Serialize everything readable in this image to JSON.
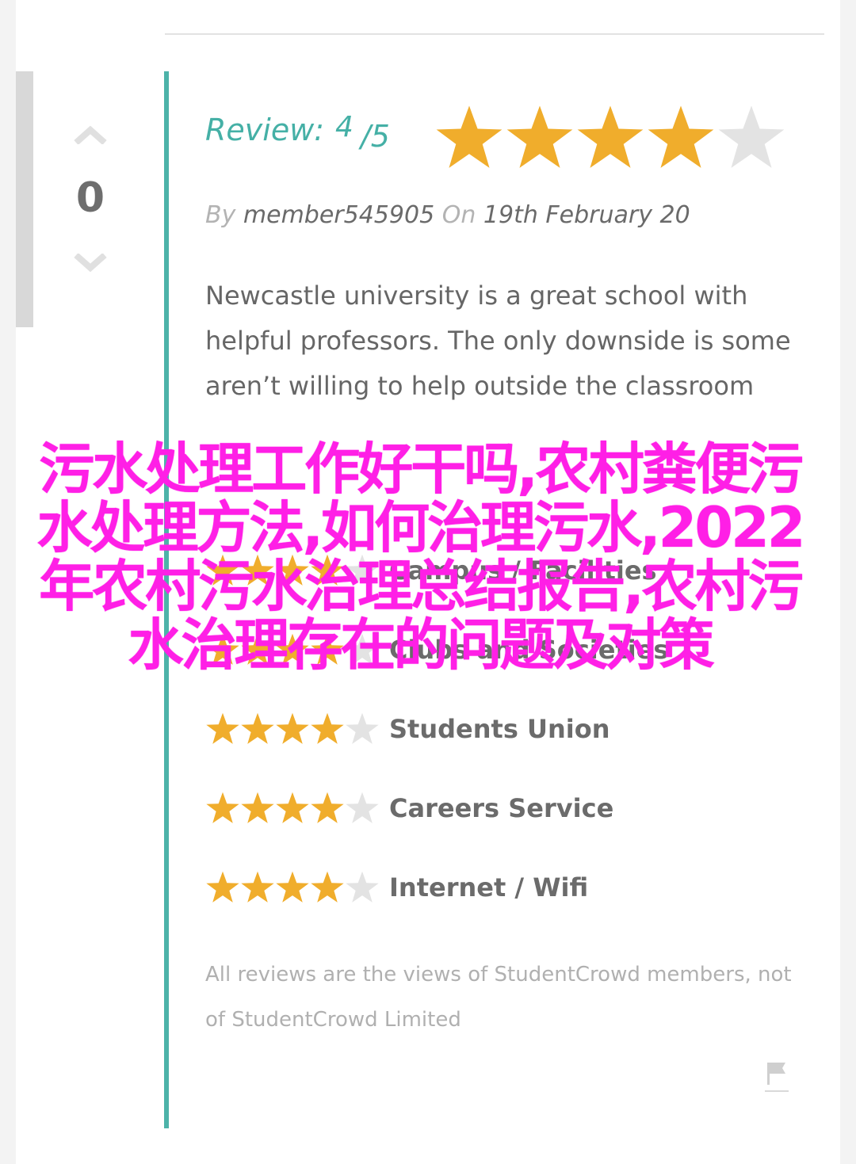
{
  "vote": {
    "count": "0"
  },
  "review": {
    "label": "Review:",
    "score": "4",
    "max": "/5",
    "stars_filled": 4,
    "stars_total": 5,
    "by_label": "By",
    "member": "member545905",
    "on_label": "On",
    "date": "19th February 20",
    "text": "Newcastle university is a great school with helpful professors. The only downside is some aren’t willing to help outside the classroom"
  },
  "ratings": [
    {
      "label": "Campus / Facilities",
      "stars": 4
    },
    {
      "label": "Clubs and Societies",
      "stars": 4
    },
    {
      "label": "Students Union",
      "stars": 4
    },
    {
      "label": "Careers Service",
      "stars": 4
    },
    {
      "label": "Internet / Wifi",
      "stars": 4
    }
  ],
  "disclaimer": "All reviews are the views of StudentCrowd members, not of StudentCrowd Limited",
  "overlay": {
    "title": "污水处理工作好干吗,农村粪便污水处理方法,如何治理污水,2022年农村污水治理总结报告,农村污水治理存在的问题及对策"
  },
  "colors": {
    "teal": "#45b0a6",
    "star_filled": "#f0ad2c",
    "star_empty": "#e3e3e3",
    "overlay": "#ff1fe6"
  },
  "icons": {
    "vote_up": "chevron-up-icon",
    "vote_down": "chevron-down-icon",
    "flag": "flag-icon",
    "star": "star-icon"
  }
}
